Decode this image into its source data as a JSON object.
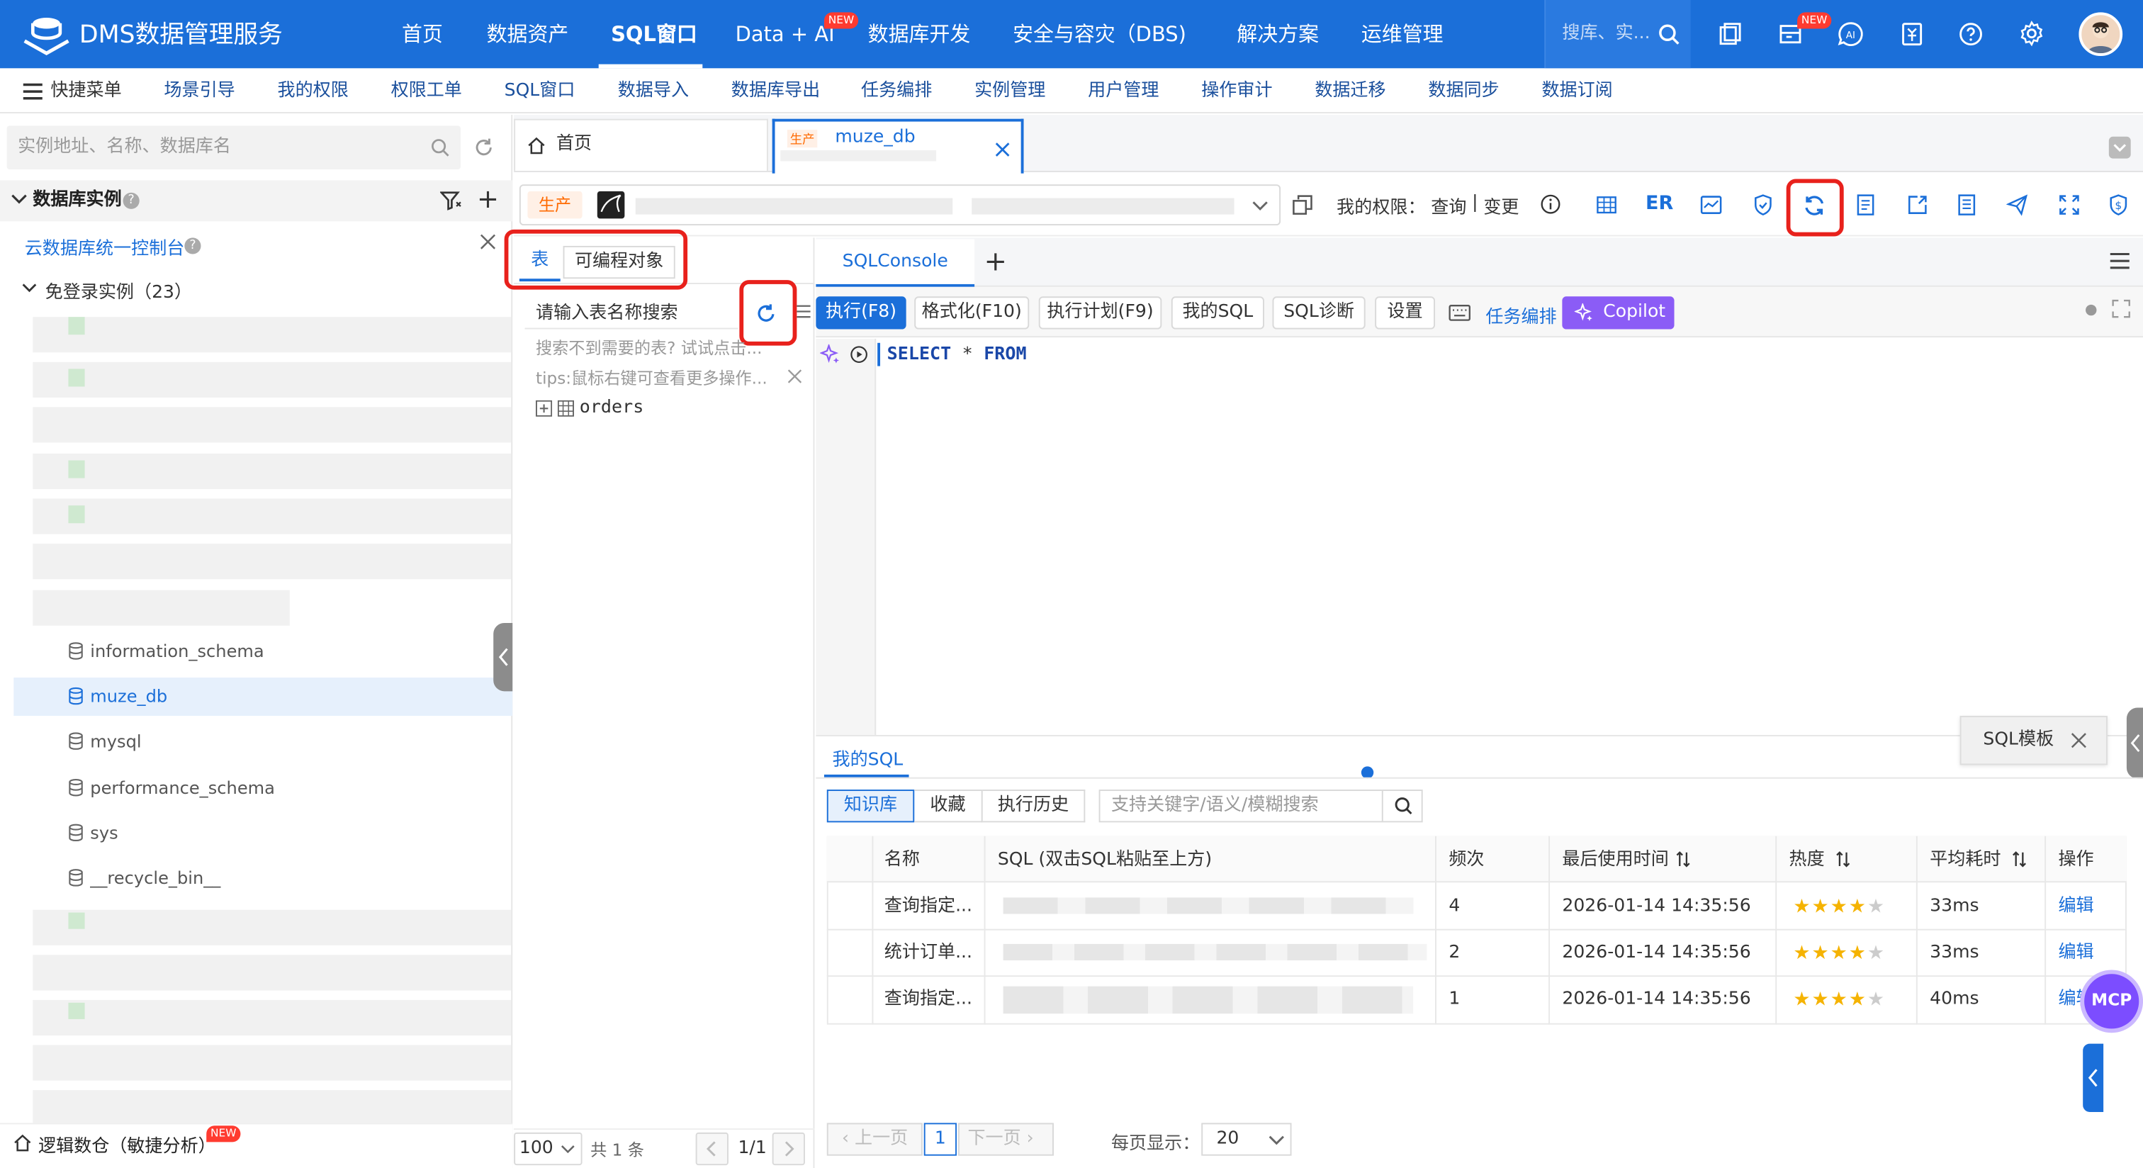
{
  "app": {
    "title": "DMS数据管理服务"
  },
  "topnav": {
    "items": [
      "首页",
      "数据资产",
      "SQL窗口",
      "Data + AI",
      "数据库开发",
      "安全与容灾（DBS)",
      "解决方案",
      "运维管理"
    ],
    "active": "SQL窗口",
    "new_badge": "NEW",
    "search_placeholder": "搜库、实..."
  },
  "quickbar": {
    "menu_label": "快捷菜单",
    "items": [
      "场景引导",
      "我的权限",
      "权限工单",
      "SQL窗口",
      "数据导入",
      "数据库导出",
      "任务编排",
      "实例管理",
      "用户管理",
      "操作审计",
      "数据迁移",
      "数据同步",
      "数据订阅"
    ]
  },
  "sidebar": {
    "search_placeholder": "实例地址、名称、数据库名",
    "section_title": "数据库实例",
    "console_link": "云数据库统一控制台",
    "group_label": "免登录实例（23）",
    "databases": [
      "information_schema",
      "muze_db",
      "mysql",
      "performance_schema",
      "sys",
      "__recycle_bin__"
    ],
    "selected_db": "muze_db",
    "footer_label": "逻辑数仓（敏捷分析）",
    "footer_badge": "NEW"
  },
  "tabs": {
    "home": "首页",
    "active_tag": "生产",
    "active_name": "muze_db"
  },
  "toolbar": {
    "env_tag": "生产",
    "perm_label": "我的权限：",
    "perm_query": "查询",
    "perm_sep": "|",
    "perm_change": "变更",
    "er_label": "ER"
  },
  "objpanel": {
    "tab_table": "表",
    "tab_prog": "可编程对象",
    "search_placeholder": "请输入表名称搜索",
    "hint1": "搜索不到需要的表? 试试点击...",
    "hint2": "tips:鼠标右键可查看更多操作...",
    "table_name": "orders",
    "page_size": "100",
    "total": "共 1 条",
    "page": "1/1"
  },
  "editor": {
    "tab": "SQLConsole",
    "add": "+",
    "buttons": [
      "执行(F8)",
      "格式化(F10)",
      "执行计划(F9)",
      "我的SQL",
      "SQL诊断",
      "设置"
    ],
    "task_label": "任务编排",
    "copilot": "Copilot",
    "code_kw1": "SELECT",
    "code_op": "*",
    "code_kw2": "FROM"
  },
  "sqltpl": {
    "label": "SQL模板"
  },
  "mysql": {
    "title": "我的SQL",
    "tabs": [
      "知识库",
      "收藏",
      "执行历史"
    ],
    "search_placeholder": "支持关键字/语义/模糊搜索",
    "columns": [
      "名称",
      "SQL (双击SQL粘贴至上方)",
      "频次",
      "最后使用时间",
      "热度",
      "平均耗时",
      "操作"
    ],
    "rows": [
      {
        "name": "查询指定...",
        "freq": "4",
        "time": "2026-01-14 14:35:56",
        "stars": 4,
        "avg": "33ms",
        "op": "编辑"
      },
      {
        "name": "统计订单...",
        "freq": "2",
        "time": "2026-01-14 14:35:56",
        "stars": 4,
        "avg": "33ms",
        "op": "编辑"
      },
      {
        "name": "查询指定...",
        "freq": "1",
        "time": "2026-01-14 14:35:56",
        "stars": 4,
        "avg": "40ms",
        "op": "编辑"
      }
    ],
    "pager": {
      "prev": "上一页",
      "page": "1",
      "next": "下一页",
      "size_label": "每页显示：",
      "size": "20"
    }
  },
  "mcp": {
    "label": "MCP"
  },
  "colors": {
    "primary": "#1b6fd9",
    "accent_red": "#e8211c",
    "copilot": "#8b5cf6",
    "env_tag": "#ff6a00"
  }
}
